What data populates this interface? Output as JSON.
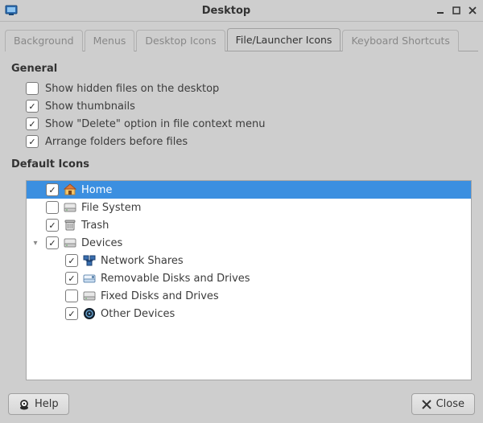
{
  "window": {
    "title": "Desktop"
  },
  "tabs": [
    {
      "label": "Background",
      "active": false
    },
    {
      "label": "Menus",
      "active": false
    },
    {
      "label": "Desktop Icons",
      "active": false
    },
    {
      "label": "File/Launcher Icons",
      "active": true
    },
    {
      "label": "Keyboard Shortcuts",
      "active": false
    }
  ],
  "sections": {
    "general": {
      "title": "General",
      "options": [
        {
          "label": "Show hidden files on the desktop",
          "checked": false
        },
        {
          "label": "Show thumbnails",
          "checked": true
        },
        {
          "label": "Show \"Delete\" option in file context menu",
          "checked": true
        },
        {
          "label": "Arrange folders before files",
          "checked": true
        }
      ]
    },
    "default_icons": {
      "title": "Default Icons",
      "tree": [
        {
          "label": "Home",
          "checked": true,
          "selected": true,
          "icon": "home",
          "depth": 0
        },
        {
          "label": "File System",
          "checked": false,
          "selected": false,
          "icon": "drive",
          "depth": 0
        },
        {
          "label": "Trash",
          "checked": true,
          "selected": false,
          "icon": "trash",
          "depth": 0
        },
        {
          "label": "Devices",
          "checked": true,
          "selected": false,
          "icon": "drive",
          "depth": 0,
          "expander": "▾"
        },
        {
          "label": "Network Shares",
          "checked": true,
          "selected": false,
          "icon": "network",
          "depth": 1
        },
        {
          "label": "Removable Disks and Drives",
          "checked": true,
          "selected": false,
          "icon": "removable",
          "depth": 1
        },
        {
          "label": "Fixed Disks and Drives",
          "checked": false,
          "selected": false,
          "icon": "drive",
          "depth": 1
        },
        {
          "label": "Other Devices",
          "checked": true,
          "selected": false,
          "icon": "other",
          "depth": 1
        }
      ]
    }
  },
  "footer": {
    "help": "Help",
    "close": "Close"
  }
}
